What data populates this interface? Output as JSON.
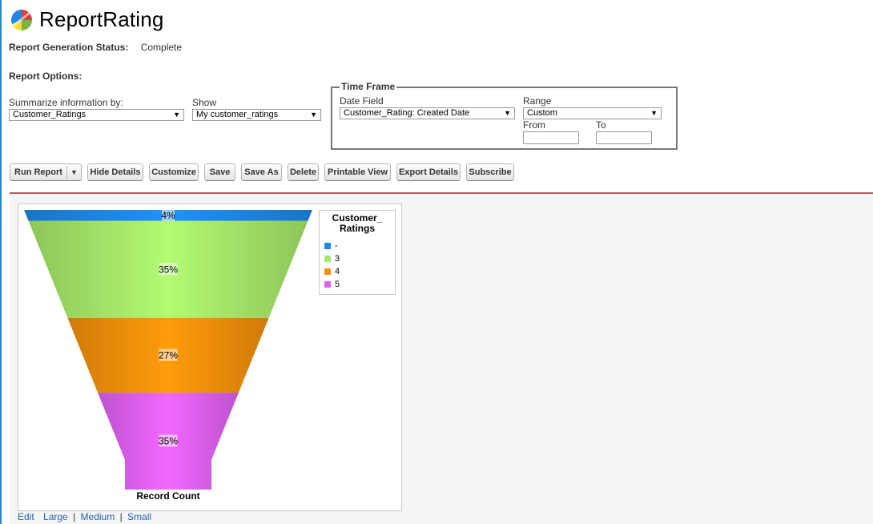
{
  "app": {
    "title": "ReportRating"
  },
  "status": {
    "label": "Report Generation Status:",
    "value": "Complete"
  },
  "options": {
    "title": "Report Options:",
    "summarize_label": "Summarize information by:",
    "summarize_value": "Customer_Ratings",
    "show_label": "Show",
    "show_value": "My customer_ratings"
  },
  "timeframe": {
    "legend": "Time Frame",
    "date_field_label": "Date Field",
    "date_field_value": "Customer_Rating: Created Date",
    "range_label": "Range",
    "range_value": "Custom",
    "from_label": "From",
    "from_value": "",
    "to_label": "To",
    "to_value": ""
  },
  "toolbar": {
    "run_report": "Run Report",
    "hide_details": "Hide Details",
    "customize": "Customize",
    "save": "Save",
    "save_as": "Save As",
    "delete": "Delete",
    "printable_view": "Printable View",
    "export_details": "Export Details",
    "subscribe": "Subscribe"
  },
  "chart_data": {
    "type": "funnel",
    "xlabel": "Record Count",
    "legend_title": "Customer_ Ratings",
    "legend_position": "top-right",
    "series": [
      {
        "name": "-",
        "percent": 4,
        "label": "4%",
        "color": "#1e88e5"
      },
      {
        "name": "3",
        "percent": 35,
        "label": "35%",
        "color": "#a6e86a"
      },
      {
        "name": "4",
        "percent": 27,
        "label": "27%",
        "color": "#f5900a"
      },
      {
        "name": "5",
        "percent": 35,
        "label": "35%",
        "color": "#e060f5"
      }
    ]
  },
  "chart_links": {
    "edit": "Edit",
    "large": "Large",
    "medium": "Medium",
    "small": "Small",
    "separator": "|"
  }
}
